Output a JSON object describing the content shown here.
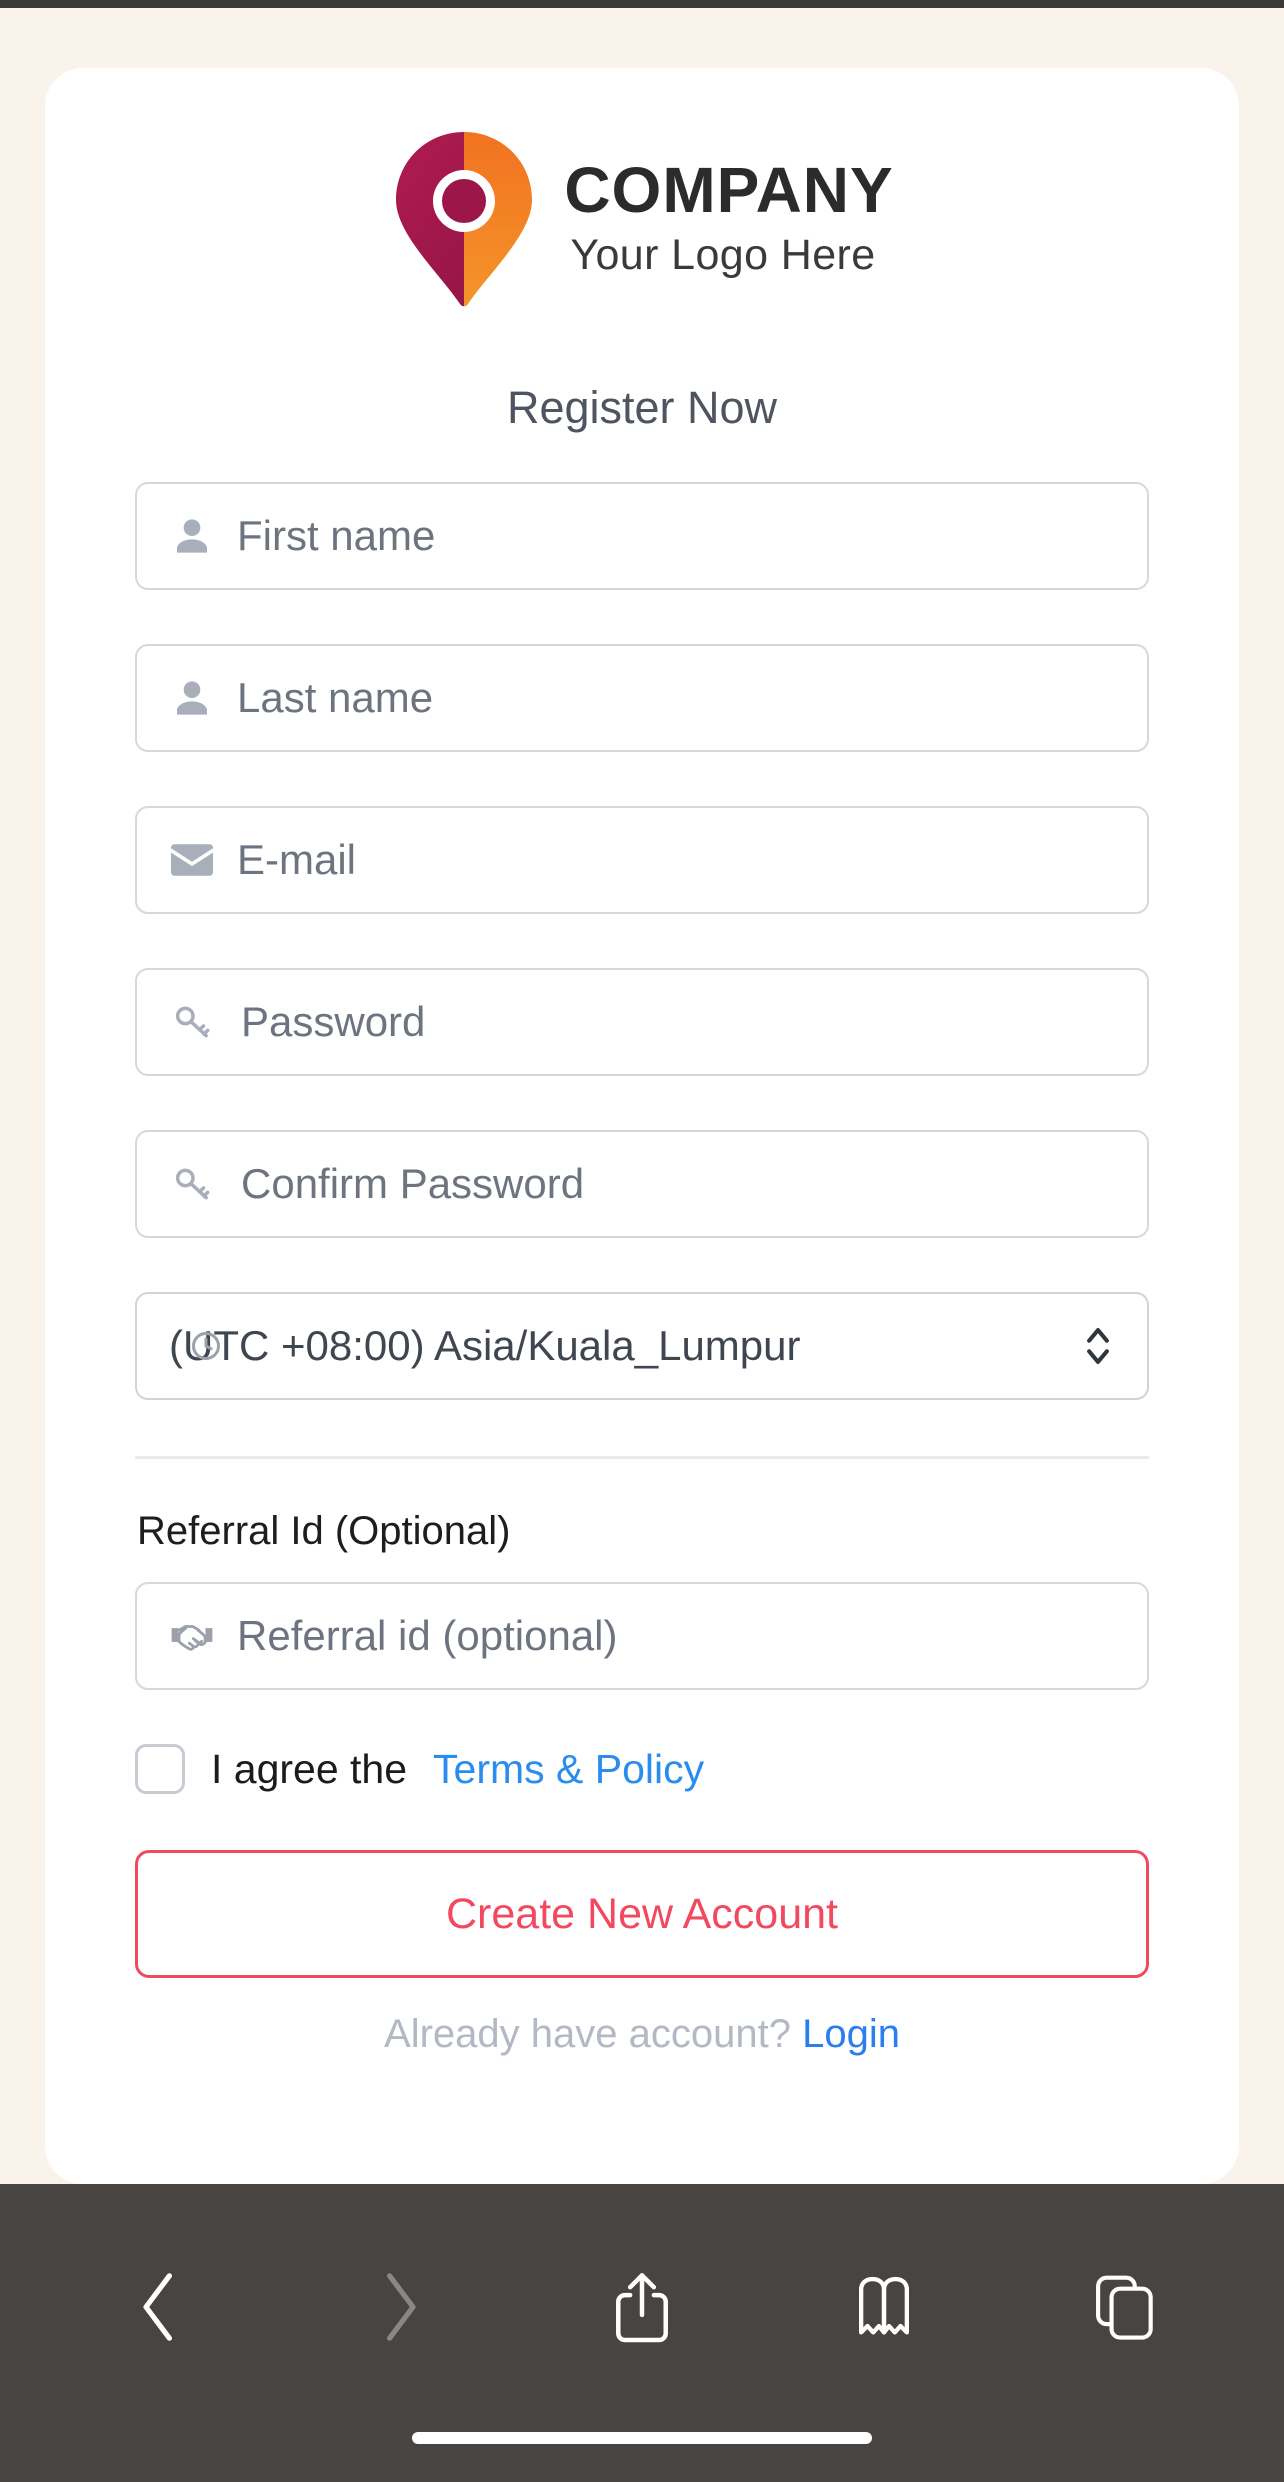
{
  "theme": {
    "page_background": "#faf3ec",
    "card_background": "#ffffff",
    "accent_red": "#f2495f",
    "link_blue": "#2b8cf0",
    "logo_magenta": "#a81b4d",
    "logo_orange": "#f07f20",
    "toolbar_background": "#474442"
  },
  "logo": {
    "icon": "map-pin-logo",
    "company": "COMPANY",
    "tagline": "Your Logo Here"
  },
  "heading": "Register Now",
  "form": {
    "fields": [
      {
        "name": "first-name",
        "icon": "person-icon",
        "placeholder": "First name",
        "value": ""
      },
      {
        "name": "last-name",
        "icon": "person-icon",
        "placeholder": "Last name",
        "value": ""
      },
      {
        "name": "email",
        "icon": "envelope-icon",
        "placeholder": "E-mail",
        "value": ""
      },
      {
        "name": "password",
        "icon": "key-icon",
        "placeholder": "Password",
        "value": ""
      },
      {
        "name": "confirm-password",
        "icon": "key-icon",
        "placeholder": "Confirm Password",
        "value": ""
      }
    ],
    "timezone": {
      "icon": "clock-icon",
      "selected": "(UTC +08:00) Asia/Kuala_Lumpur",
      "chevron": "chevron-up-down-icon"
    },
    "referral": {
      "label": "Referral Id (Optional)",
      "icon": "handshake-icon",
      "placeholder": "Referral id (optional)",
      "value": ""
    },
    "terms": {
      "checked": false,
      "text": "I agree the",
      "link": "Terms & Policy"
    },
    "submit_label": "Create New Account",
    "login_prompt": "Already have account?",
    "login_link": "Login"
  },
  "browser_toolbar": {
    "back": "back-icon",
    "forward": "forward-icon",
    "share": "share-icon",
    "bookmarks": "bookmarks-icon",
    "tabs": "tabs-icon"
  }
}
